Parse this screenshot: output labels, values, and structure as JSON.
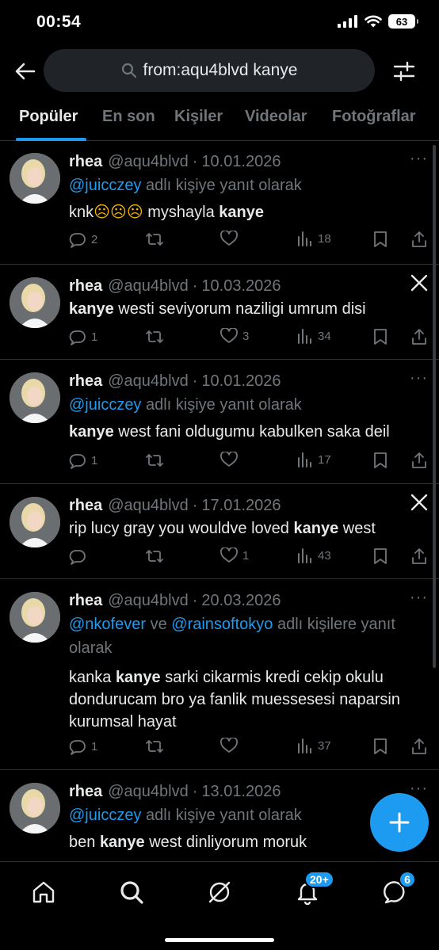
{
  "status_bar": {
    "time": "00:54",
    "battery": "63"
  },
  "search": {
    "query": "from:aqu4blvd kanye"
  },
  "tabs": [
    {
      "label": "Popüler",
      "active": true
    },
    {
      "label": "En son",
      "active": false
    },
    {
      "label": "Kişiler",
      "active": false
    },
    {
      "label": "Videolar",
      "active": false
    },
    {
      "label": "Fotoğraflar",
      "active": false
    }
  ],
  "tweets": [
    {
      "name": "rhea",
      "handle": "@aqu4blvd",
      "sep": "·",
      "date": "10.01.2026",
      "reply_to": "@juicczey",
      "reply_suffix": " adlı kişiye yanıt olarak",
      "text_before": "knk",
      "emoji": "☹☹☹",
      "text_middle": " myshayla ",
      "keyword": "kanye",
      "text_after": "",
      "replies": "2",
      "retweets": "",
      "likes": "",
      "views": "18"
    },
    {
      "name": "rhea",
      "handle": "@aqu4blvd",
      "sep": "·",
      "date": "10.03.2026",
      "keyword": "kanye",
      "text_after": " westi seviyorum naziligi umrum disi",
      "replies": "1",
      "retweets": "",
      "likes": "3",
      "views": "34"
    },
    {
      "name": "rhea",
      "handle": "@aqu4blvd",
      "sep": "·",
      "date": "10.01.2026",
      "reply_to": "@juicczey",
      "reply_suffix": " adlı kişiye yanıt olarak",
      "keyword": "kanye",
      "text_after": " west fani oldugumu kabulken saka deil",
      "replies": "1",
      "retweets": "",
      "likes": "",
      "views": "17"
    },
    {
      "name": "rhea",
      "handle": "@aqu4blvd",
      "sep": "·",
      "date": "17.01.2026",
      "text_before": "rip lucy gray you wouldve loved ",
      "keyword": "kanye",
      "text_after": " west",
      "replies": "",
      "retweets": "",
      "likes": "1",
      "views": "43"
    },
    {
      "name": "rhea",
      "handle": "@aqu4blvd",
      "sep": "·",
      "date": "20.03.2026",
      "reply_to_1": "@nkofever",
      "reply_and": " ve ",
      "reply_to_2": "@rainsoftokyo",
      "reply_suffix_a": " adlı kişilere yanıt",
      "reply_suffix_b": "olarak",
      "text_before": "kanka ",
      "keyword": "kanye",
      "text_line1_after": " sarki cikarmis kredi cekip okulu",
      "text_line2": "dondurucam bro ya fanlik muessesesi naparsin",
      "text_line3": "kurumsal hayat",
      "replies": "1",
      "retweets": "",
      "likes": "",
      "views": "37"
    },
    {
      "name": "rhea",
      "handle": "@aqu4blvd",
      "sep": "·",
      "date": "13.01.2026",
      "reply_to": "@juicczey",
      "reply_suffix": " adlı kişiye yanıt olarak",
      "text_before": "ben ",
      "keyword": "kanye",
      "text_after": " west dinliyorum moruk"
    }
  ],
  "nav": {
    "notifications_badge": "20+",
    "messages_badge": "6"
  },
  "colors": {
    "accent": "#1d9bf0",
    "muted": "#71767b",
    "text": "#e7e9ea",
    "divider": "#2f3336"
  }
}
